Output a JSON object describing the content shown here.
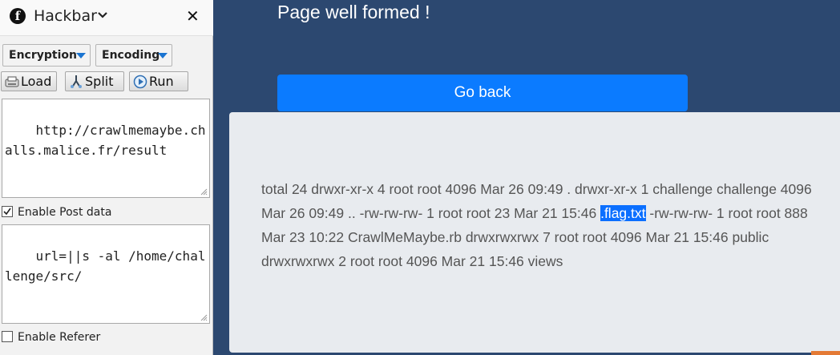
{
  "hackbar": {
    "title": "Hackbar",
    "encryption_label": "Encryption",
    "encoding_label": "Encoding",
    "load_label": "Load",
    "split_label": "Split",
    "run_label": "Run",
    "url_value": "http://crawlmemaybe.challs.malice.fr/result",
    "post_enabled_label": "Enable Post data",
    "post_enabled": true,
    "post_value": "url=||s -al /home/challenge/src/",
    "referer_label": "Enable Referer",
    "referer_enabled": false
  },
  "page": {
    "title": "Page well formed !",
    "go_back_label": "Go back",
    "output_before": "total 24 drwxr-xr-x 4 root root 4096 Mar 26 09:49 . drwxr-xr-x 1 challenge challenge 4096 Mar 26 09:49 .. -rw-rw-rw- 1 root root 23 Mar 21 15:46 ",
    "output_highlight": ".flag.txt",
    "output_after": " -rw-rw-rw- 1 root root 888 Mar 23 10:22 CrawlMeMaybe.rb drwxrwxrwx 7 root root 4096 Mar 21 15:46 public drwxrwxrwx 2 root root 4096 Mar 21 15:46 views"
  },
  "colors": {
    "page_background": "#2c4870",
    "button_blue": "#0b7bff",
    "panel_background": "#e8ebef",
    "selection_highlight": "#0b6fff"
  },
  "icons": [
    "hackbar-logo-icon",
    "chevron-down-icon",
    "close-icon",
    "load-icon",
    "split-icon",
    "run-icon"
  ]
}
